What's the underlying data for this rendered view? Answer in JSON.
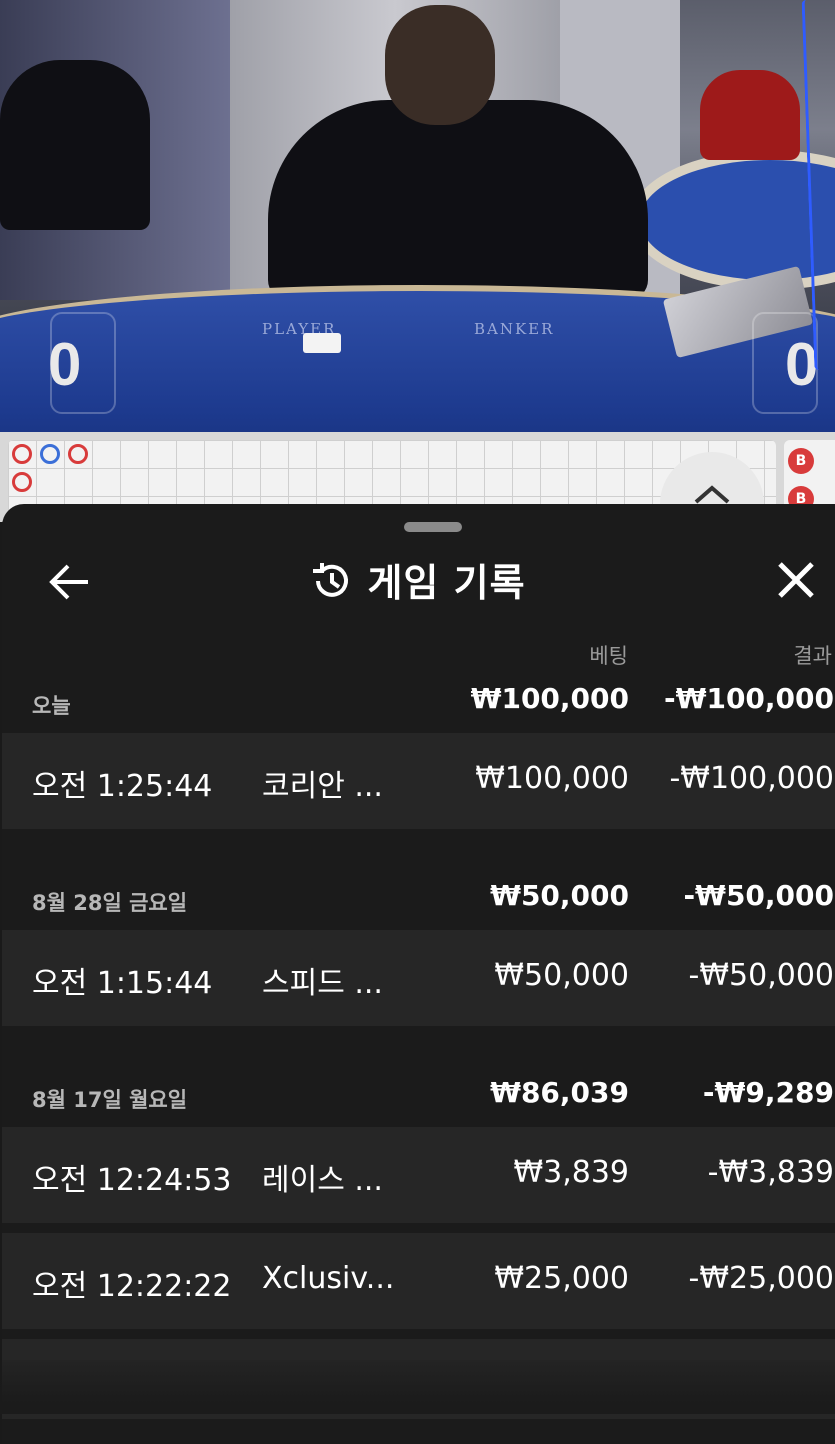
{
  "video": {
    "felt_player": "PLAYER",
    "felt_banker": "BANKER",
    "player_score": "0",
    "banker_score": "0"
  },
  "roadmap": {
    "rings": [
      "red",
      "blue",
      "red",
      "red"
    ],
    "bead_label": "B"
  },
  "sheet": {
    "title": "게임 기록",
    "col_bet": "베팅",
    "col_result": "결과"
  },
  "history": [
    {
      "label": "오늘",
      "bet": "₩100,000",
      "result": "-₩100,000",
      "items": [
        {
          "time": "오전 1:25:44",
          "game": "코리안 ...",
          "bet": "₩100,000",
          "result": "-₩100,000"
        }
      ]
    },
    {
      "label": "8월 28일 금요일",
      "bet": "₩50,000",
      "result": "-₩50,000",
      "items": [
        {
          "time": "오전 1:15:44",
          "game": "스피드 ...",
          "bet": "₩50,000",
          "result": "-₩50,000"
        }
      ]
    },
    {
      "label": "8월 17일 월요일",
      "bet": "₩86,039",
      "result": "-₩9,289",
      "items": [
        {
          "time": "오전 12:24:53",
          "game": "레이스 ...",
          "bet": "₩3,839",
          "result": "-₩3,839"
        },
        {
          "time": "오전 12:22:22",
          "game": "Xclusiv...",
          "bet": "₩25,000",
          "result": "-₩25,000"
        }
      ]
    }
  ],
  "colors": {
    "sheet_bg": "#1b1b1b",
    "row_bg": "#262626",
    "muted_text": "#9a9a9a",
    "felt_blue": "#1d3a8e",
    "road_red": "#d83b3b",
    "road_blue": "#3b6fd8"
  },
  "icons": [
    "back-arrow-icon",
    "history-icon",
    "close-icon",
    "chevron-up-icon"
  ]
}
